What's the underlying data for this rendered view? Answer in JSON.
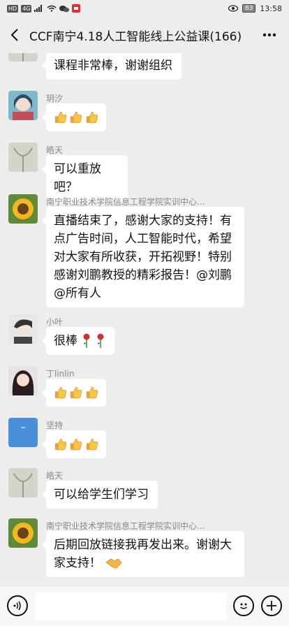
{
  "status_bar": {
    "left_badges": [
      "HD",
      "4G"
    ],
    "battery": "83",
    "time": "13:58"
  },
  "header": {
    "back_icon": "chevron-left",
    "title": "CCF南宁4.18人工智能线上公益课(166)",
    "more_icon": "ellipsis"
  },
  "messages": [
    {
      "name": "",
      "text": "课程非常棒，谢谢组织"
    },
    {
      "name": "玥汐",
      "emoji": [
        "thumbs-up",
        "thumbs-up",
        "thumbs-up"
      ]
    },
    {
      "name": "皓天",
      "text": "可以重放吧？"
    },
    {
      "name": "南宁职业技术学院信息工程学院实训中心...",
      "lines": [
        "直播结束了，感谢大家的支持！有",
        "点广告时间，人工智能时代，希望",
        "对大家有所收获，开拓视野！特别",
        "感谢刘鹏教授的精彩报告！@刘鹏",
        "@所有人"
      ]
    },
    {
      "name": "小叶",
      "text": "很棒",
      "emoji": [
        "rose",
        "rose"
      ]
    },
    {
      "name": "丁linlin",
      "emoji": [
        "thumbs-up",
        "thumbs-up",
        "thumbs-up"
      ]
    },
    {
      "name": "坚持",
      "emoji": [
        "thumbs-up",
        "thumbs-up",
        "thumbs-up"
      ]
    },
    {
      "name": "皓天",
      "text": "可以给学生们学习"
    },
    {
      "name": "南宁职业技术学院信息工程学院实训中心...",
      "lines": [
        "后期回放链接我再发出来。谢谢大",
        "家支持！"
      ],
      "emoji": [
        "handshake"
      ]
    }
  ],
  "input_bar": {
    "voice_icon": "voice",
    "emoji_icon": "smiley",
    "plus_icon": "plus"
  }
}
